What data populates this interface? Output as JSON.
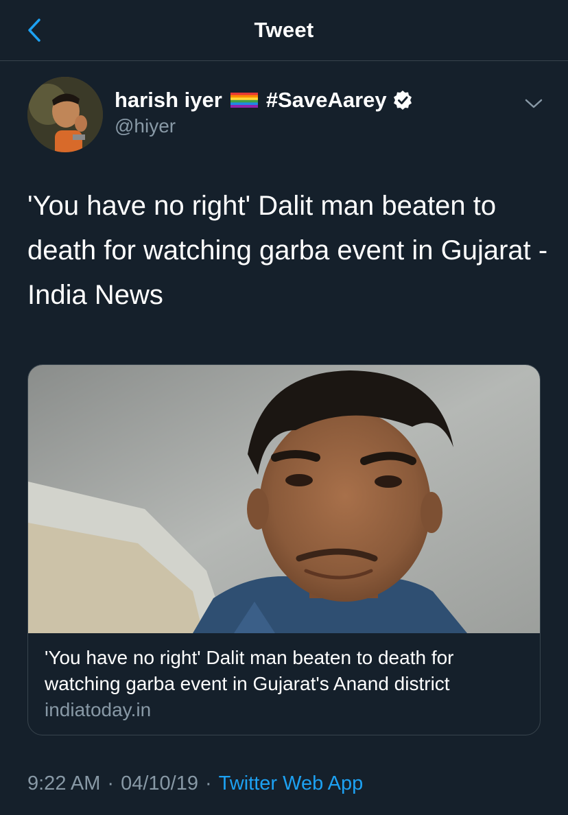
{
  "header": {
    "title": "Tweet",
    "back_icon": "chevron-left-icon"
  },
  "author": {
    "display_name": "harish iyer",
    "flag_icon": "rainbow-flag-icon",
    "hashtag": "#SaveAarey",
    "verified_icon": "verified-badge-icon",
    "handle": "@hiyer",
    "menu_icon": "chevron-down-icon"
  },
  "tweet": {
    "text": "'You have no right' Dalit man beaten to death for watching garba event in Gujarat - India News"
  },
  "card": {
    "title": "'You have no right' Dalit man beaten to death for watching garba event in Gujarat's Anand district",
    "domain": "indiatoday.in"
  },
  "meta": {
    "time": "9:22 AM",
    "date": "04/10/19",
    "separator": "·",
    "source": "Twitter Web App"
  },
  "colors": {
    "background": "#15202b",
    "border": "#38444d",
    "secondary_text": "#8899a6",
    "accent": "#1da1f2"
  }
}
